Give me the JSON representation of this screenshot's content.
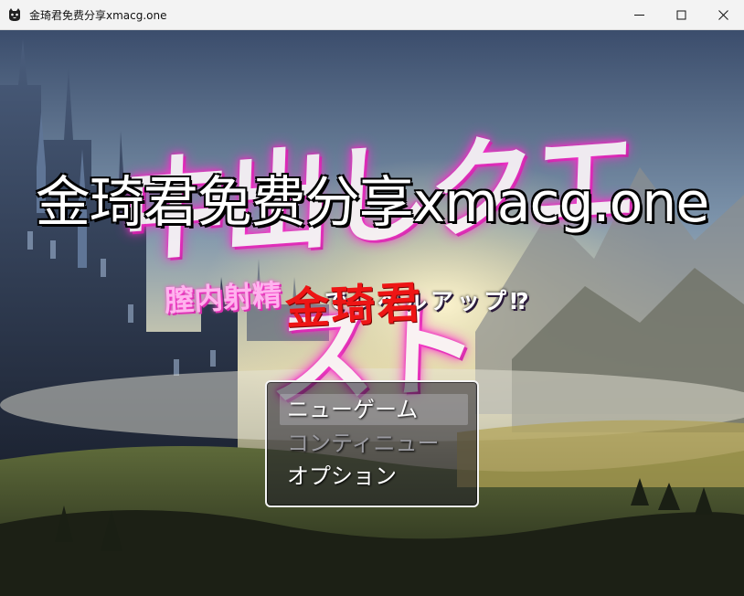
{
  "window": {
    "title": "金琦君免费分享xmacg.one",
    "icon": "cat-app-icon",
    "controls": [
      "minimize-icon",
      "maximize-icon",
      "close-icon"
    ]
  },
  "title_screen": {
    "logo_title": "中出しクエスト",
    "logo_subtitle": "膣内射精",
    "logo_tail": "でレベルアップ⁉",
    "watermark_text": "金琦君免费分享xmacg.one",
    "watermark_red": "金琦君"
  },
  "menu": {
    "items": [
      {
        "label": "ニューゲーム",
        "state": "selected"
      },
      {
        "label": "コンティニュー",
        "state": "disabled"
      },
      {
        "label": "オプション",
        "state": "enabled"
      }
    ]
  },
  "colors": {
    "logo_glow": "#ff2fd0",
    "watermark_red": "#ee1515",
    "menu_border": "#f4f4f4"
  }
}
